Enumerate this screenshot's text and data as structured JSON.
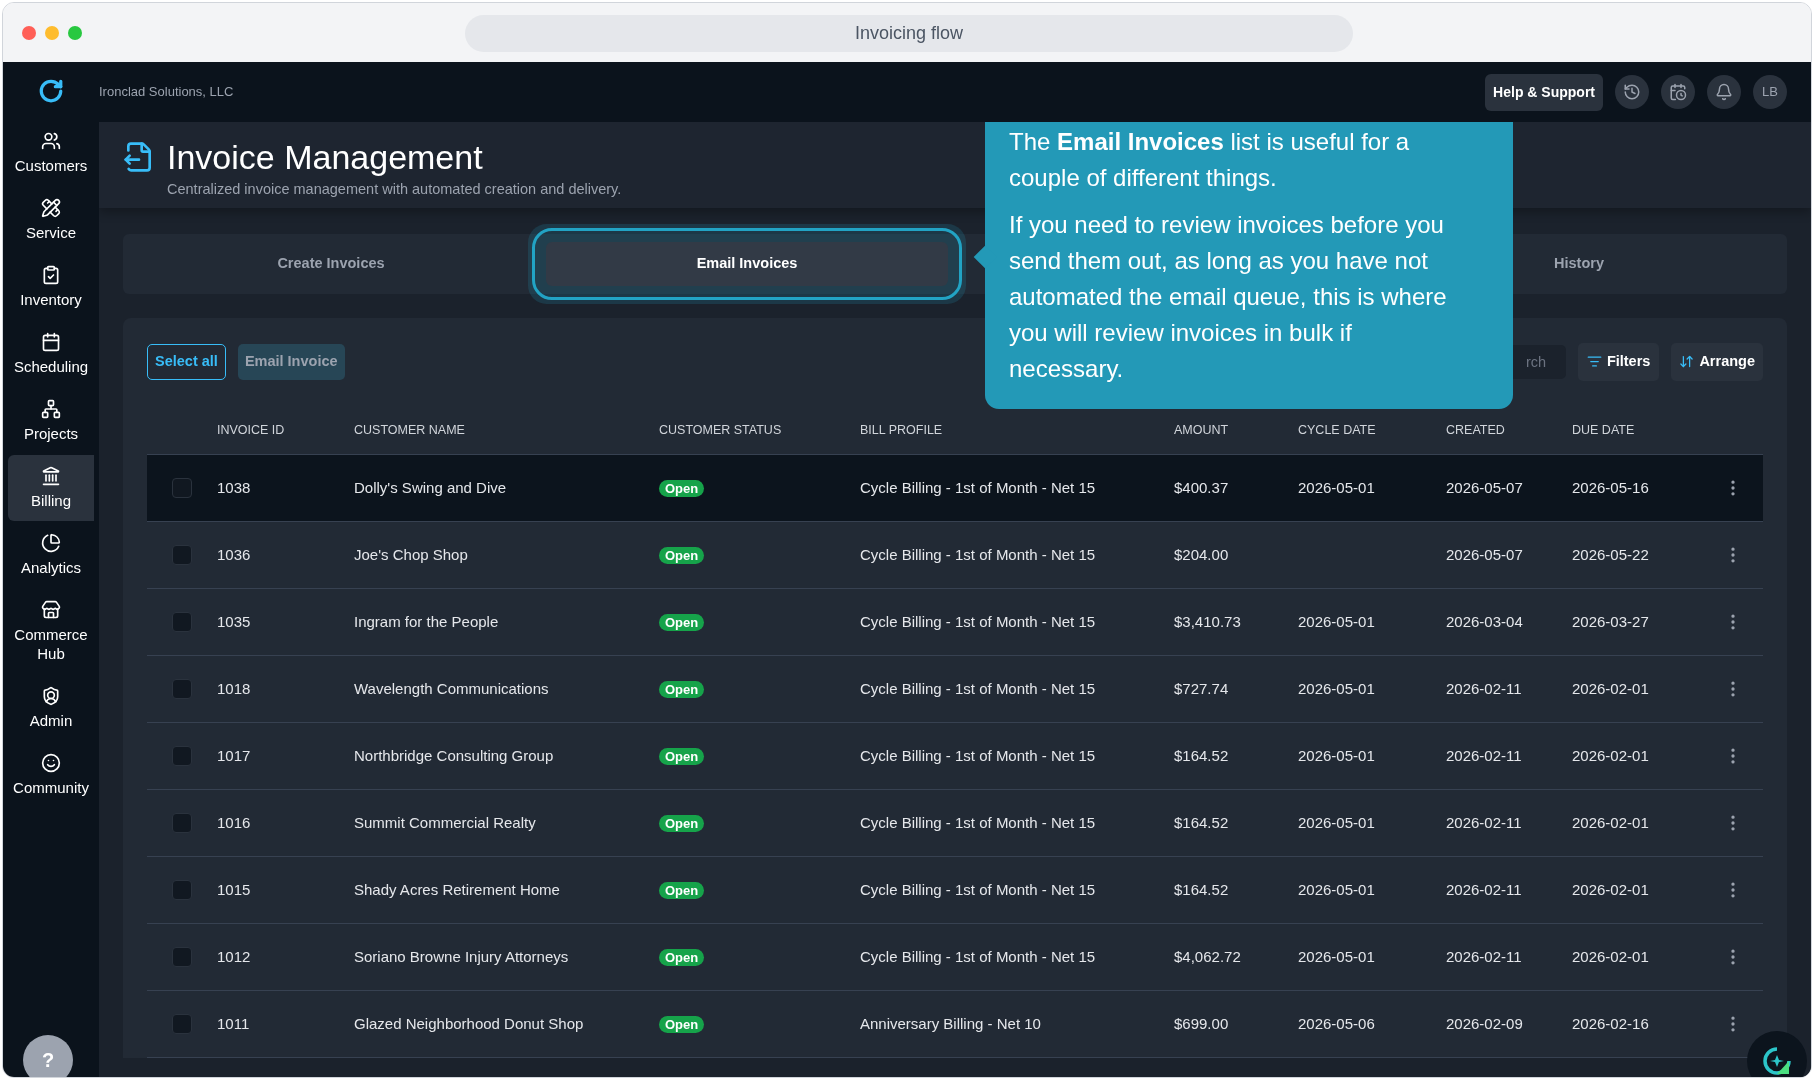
{
  "browser": {
    "address": "Invoicing flow"
  },
  "company": "Ironclad Solutions, LLC",
  "header_actions": {
    "help": "Help & Support",
    "avatar": "LB"
  },
  "sidebar": {
    "items": [
      {
        "label": "Customers",
        "selected": false
      },
      {
        "label": "Service",
        "selected": false
      },
      {
        "label": "Inventory",
        "selected": false
      },
      {
        "label": "Scheduling",
        "selected": false
      },
      {
        "label": "Projects",
        "selected": false
      },
      {
        "label": "Billing",
        "selected": true
      },
      {
        "label": "Analytics",
        "selected": false
      },
      {
        "label": "Commerce Hub",
        "selected": false
      },
      {
        "label": "Admin",
        "selected": false
      },
      {
        "label": "Community",
        "selected": false
      }
    ]
  },
  "page": {
    "title": "Invoice Management",
    "subtitle": "Centralized invoice management with automated creation and delivery."
  },
  "tabs": [
    {
      "label": "Create Invoices",
      "selected": false
    },
    {
      "label": "Email Invoices",
      "selected": true
    },
    {
      "label": "History",
      "selected": false
    }
  ],
  "toolbar": {
    "select_all": "Select all",
    "email_invoice": "Email Invoice",
    "search_placeholder": "rch",
    "filters": "Filters",
    "arrange": "Arrange"
  },
  "table": {
    "columns": [
      "INVOICE ID",
      "CUSTOMER NAME",
      "CUSTOMER STATUS",
      "BILL PROFILE",
      "AMOUNT",
      "CYCLE DATE",
      "CREATED",
      "DUE DATE"
    ],
    "rows": [
      {
        "id": "1038",
        "customer": "Dolly's Swing and Dive",
        "status": "Open",
        "bill_profile": "Cycle Billing - 1st of Month - Net 15",
        "amount": "$400.37",
        "cycle_date": "2026-05-01",
        "created": "2026-05-07",
        "due": "2026-05-16",
        "selected": true,
        "checked": false
      },
      {
        "id": "1036",
        "customer": "Joe's Chop Shop",
        "status": "Open",
        "bill_profile": "Cycle Billing - 1st of Month - Net 15",
        "amount": "$204.00",
        "created": "2026-05-07",
        "due": "2026-05-22",
        "selected": false,
        "checked": false
      },
      {
        "id": "1035",
        "customer": "Ingram for the People",
        "status": "Open",
        "bill_profile": "Cycle Billing - 1st of Month - Net 15",
        "amount": "$3,410.73",
        "cycle_date": "2026-05-01",
        "created": "2026-03-04",
        "due": "2026-03-27",
        "selected": false,
        "checked": false
      },
      {
        "id": "1018",
        "customer": "Wavelength Communications",
        "status": "Open",
        "bill_profile": "Cycle Billing - 1st of Month - Net 15",
        "amount": "$727.74",
        "cycle_date": "2026-05-01",
        "created": "2026-02-11",
        "due": "2026-02-01",
        "selected": false,
        "checked": false
      },
      {
        "id": "1017",
        "customer": "Northbridge Consulting Group",
        "status": "Open",
        "bill_profile": "Cycle Billing - 1st of Month - Net 15",
        "amount": "$164.52",
        "cycle_date": "2026-05-01",
        "created": "2026-02-11",
        "due": "2026-02-01",
        "selected": false,
        "checked": false
      },
      {
        "id": "1016",
        "customer": "Summit Commercial Realty",
        "status": "Open",
        "bill_profile": "Cycle Billing - 1st of Month - Net 15",
        "amount": "$164.52",
        "cycle_date": "2026-05-01",
        "created": "2026-02-11",
        "due": "2026-02-01",
        "selected": false,
        "checked": false
      },
      {
        "id": "1015",
        "customer": "Shady Acres Retirement Home",
        "status": "Open",
        "bill_profile": "Cycle Billing - 1st of Month - Net 15",
        "amount": "$164.52",
        "cycle_date": "2026-05-01",
        "created": "2026-02-11",
        "due": "2026-02-01",
        "selected": false,
        "checked": false
      },
      {
        "id": "1012",
        "customer": "Soriano Browne Injury Attorneys",
        "status": "Open",
        "bill_profile": "Cycle Billing - 1st of Month - Net 15",
        "amount": "$4,062.72",
        "cycle_date": "2026-05-01",
        "created": "2026-02-11",
        "due": "2026-02-01",
        "selected": false,
        "checked": false
      },
      {
        "id": "1011",
        "customer": "Glazed Neighborhood Donut Shop",
        "status": "Open",
        "bill_profile": "Anniversary Billing - Net 10",
        "amount": "$699.00",
        "cycle_date": "2026-05-06",
        "created": "2026-02-09",
        "due": "2026-02-16",
        "selected": false,
        "checked": false
      }
    ]
  },
  "tooltip": {
    "paragraphs": [
      "The **Email Invoices** list is useful for a couple of different things.",
      "If you need to review invoices before you send them out, as long as you have not automated the email queue, this is where you will review invoices in bulk if necessary."
    ]
  },
  "help_button": "?"
}
